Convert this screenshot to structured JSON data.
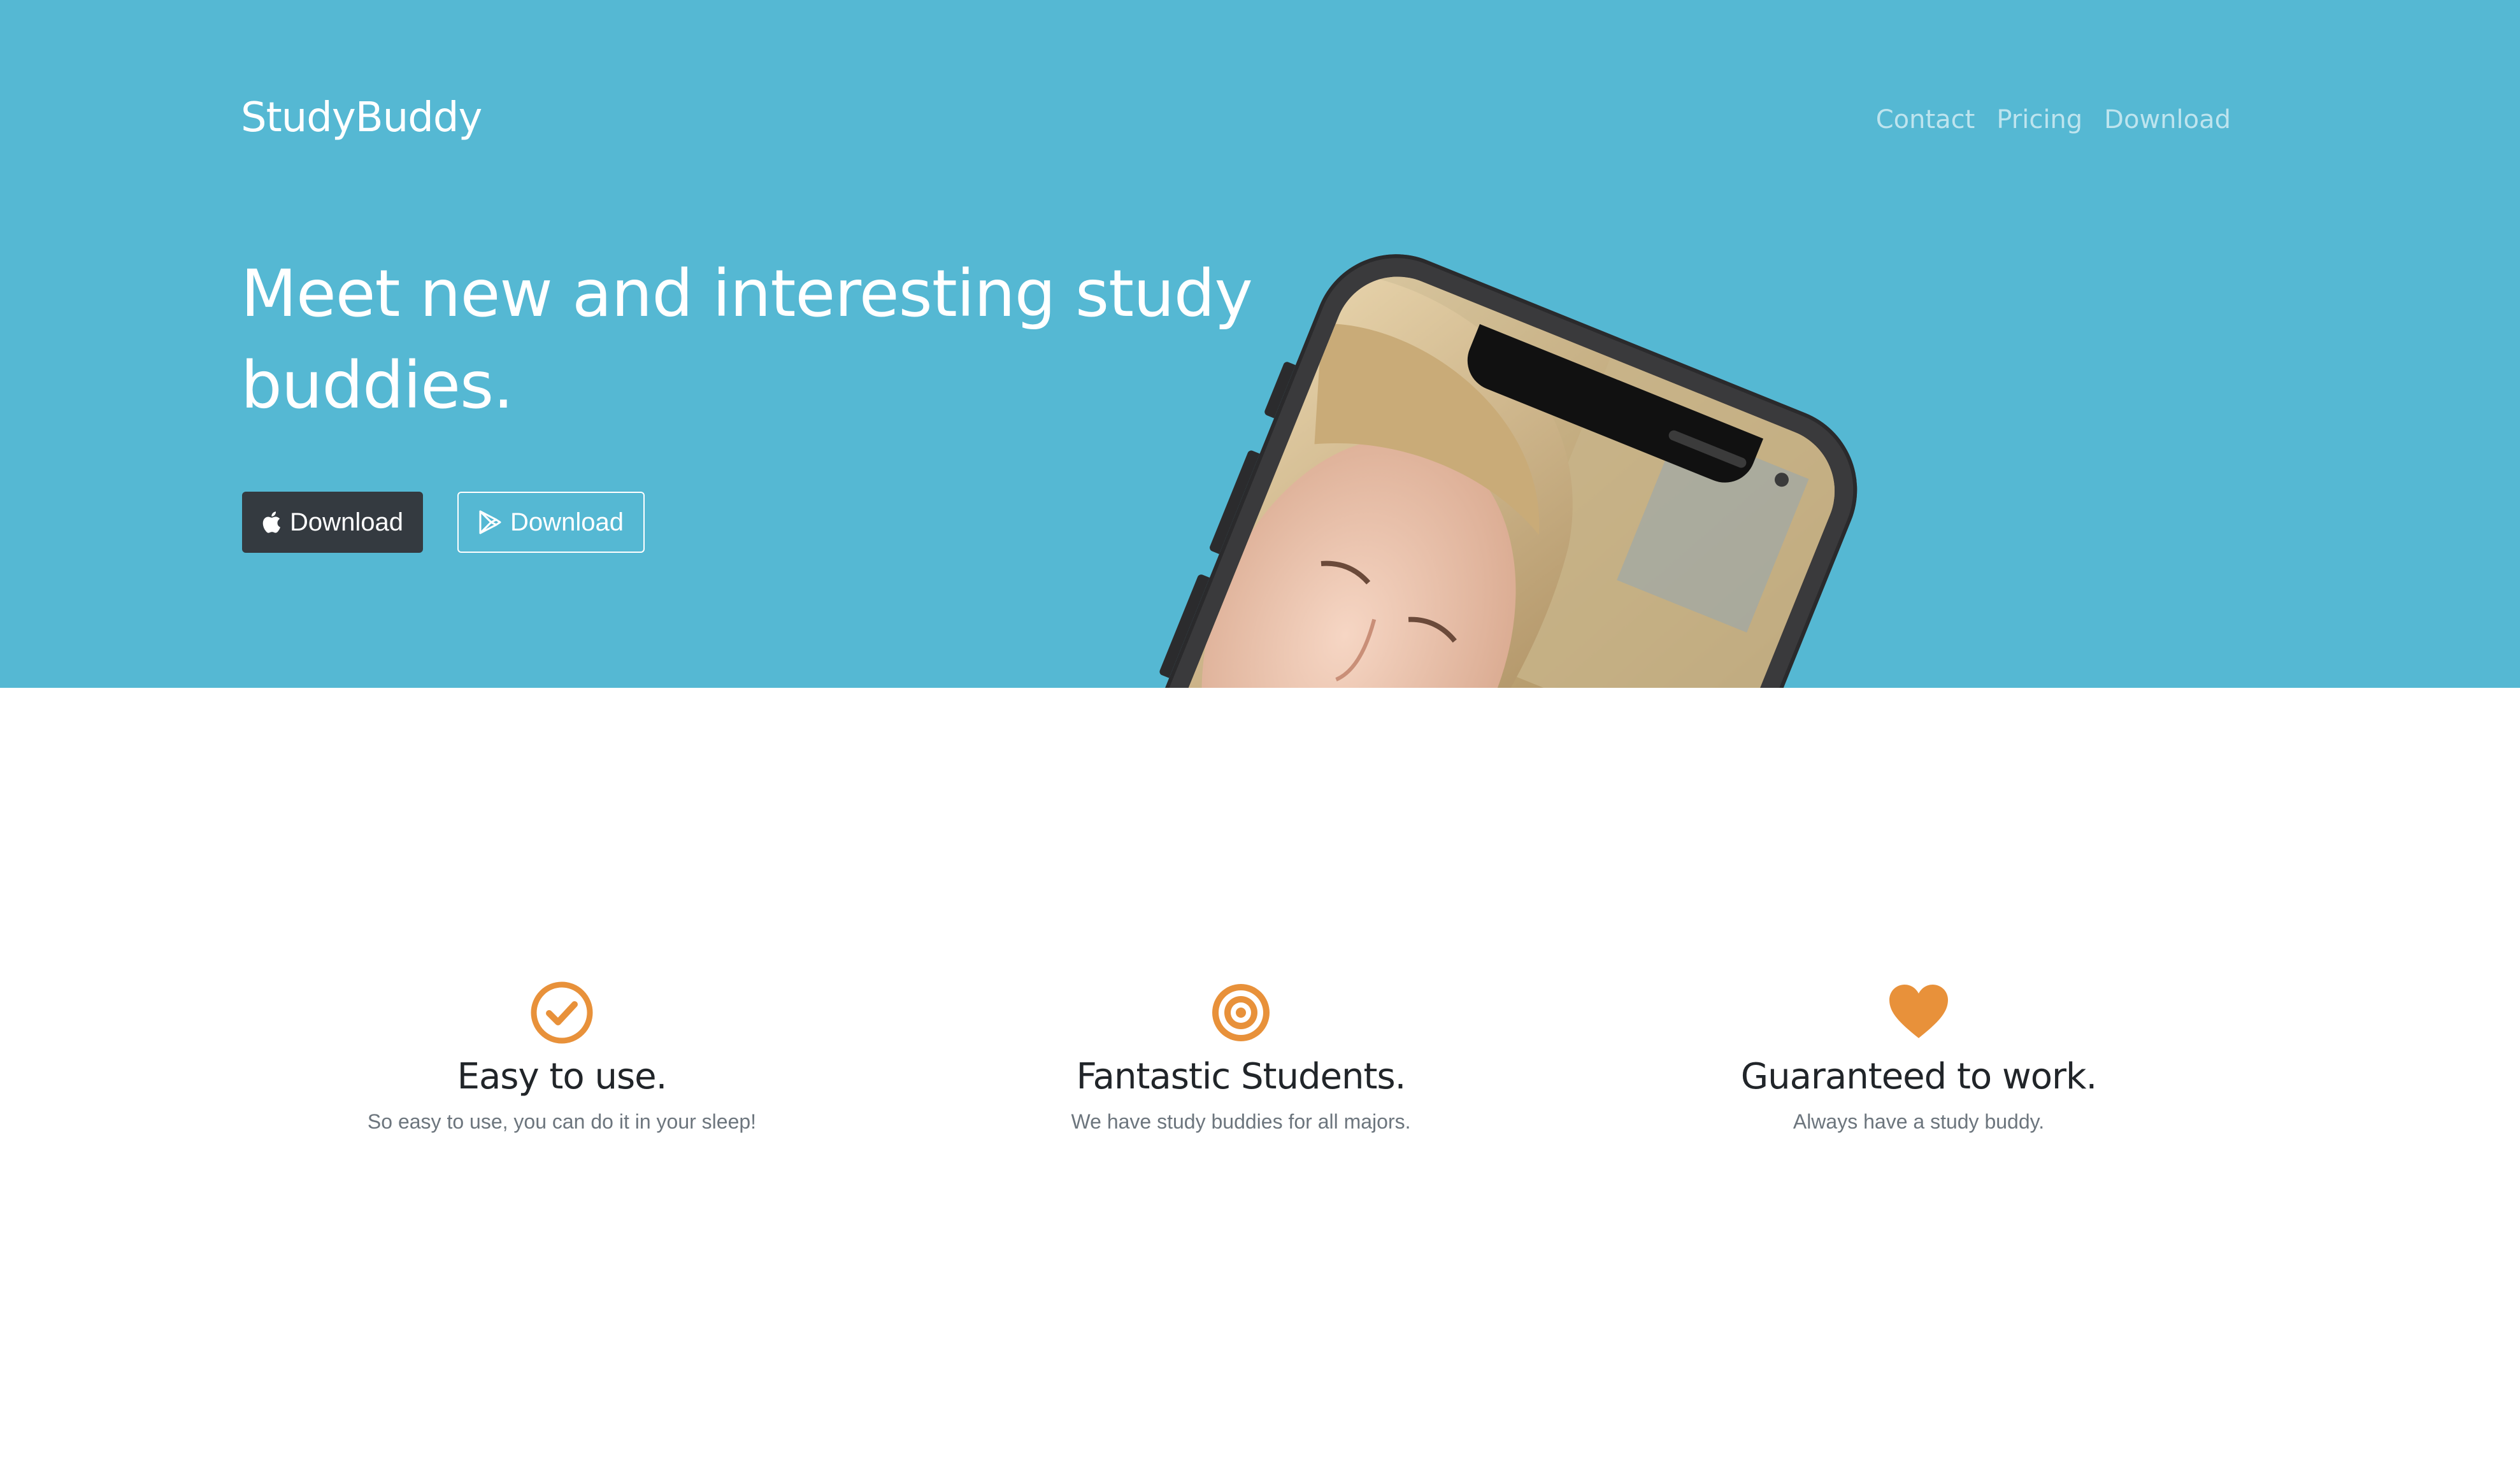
{
  "header": {
    "brand": "StudyBuddy",
    "nav": [
      {
        "label": "Contact"
      },
      {
        "label": "Pricing"
      },
      {
        "label": "Download"
      }
    ]
  },
  "hero": {
    "headline": "Meet new and interesting study buddies.",
    "buttons": {
      "apple": {
        "label": "Download",
        "icon": "apple-icon"
      },
      "google": {
        "label": "Download",
        "icon": "google-play-icon"
      }
    },
    "image": "phone-with-students-photo"
  },
  "features": [
    {
      "icon": "check-circle-icon",
      "title": "Easy to use.",
      "text": "So easy to use, you can do it in your sleep!"
    },
    {
      "icon": "bullseye-icon",
      "title": "Fantastic Students.",
      "text": "We have study buddies for all majors."
    },
    {
      "icon": "heart-icon",
      "title": "Guaranteed to work.",
      "text": "Always have a study buddy."
    }
  ],
  "colors": {
    "hero_bg": "#55b8d3",
    "accent": "#e8913a",
    "dark_button": "#343a40"
  }
}
